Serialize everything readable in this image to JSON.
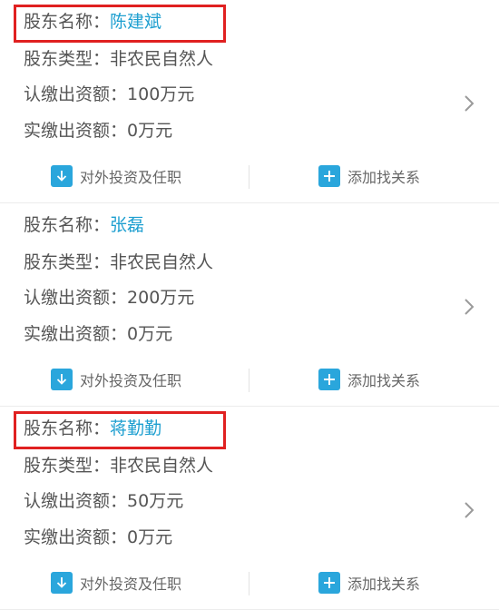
{
  "labels": {
    "name": "股东名称：",
    "type": "股东类型：",
    "subscribed": "认缴出资额：",
    "paid": "实缴出资额："
  },
  "actions": {
    "invest": "对外投资及任职",
    "add_relation": "添加找关系"
  },
  "shareholders": [
    {
      "name": "陈建斌",
      "type": "非农民自然人",
      "subscribed": "100万元",
      "paid": "0万元",
      "highlighted": true
    },
    {
      "name": "张磊",
      "type": "非农民自然人",
      "subscribed": "200万元",
      "paid": "0万元",
      "highlighted": false
    },
    {
      "name": "蒋勤勤",
      "type": "非农民自然人",
      "subscribed": "50万元",
      "paid": "0万元",
      "highlighted": true
    }
  ],
  "colors": {
    "accent": "#1e9fd0",
    "icon_bg": "#2aa6dc",
    "highlight_border": "#e02020"
  },
  "icons": [
    "download-icon",
    "plus-icon",
    "chevron-right-icon"
  ]
}
